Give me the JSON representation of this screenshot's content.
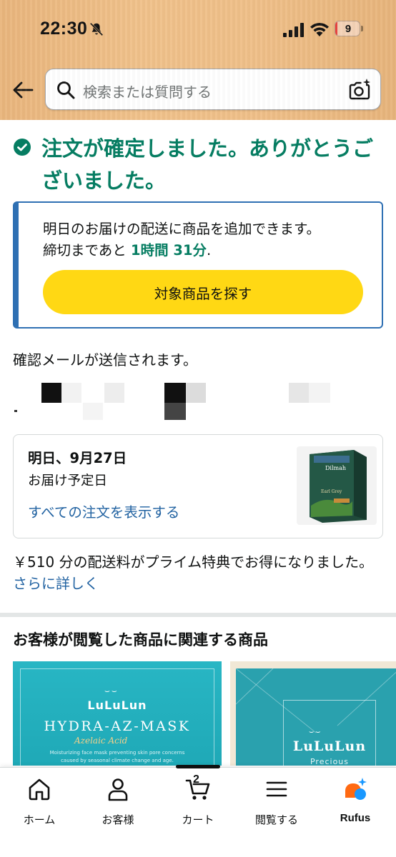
{
  "status_bar": {
    "time": "22:30",
    "battery_level": "9",
    "battery_fraction": 0.09
  },
  "search": {
    "placeholder": "検索または質問する"
  },
  "confirmation": {
    "message": "注文が確定しました。ありがとうございました。"
  },
  "delivery_upsell": {
    "line1": "明日のお届けの配送に商品を追加できます。",
    "line2_prefix": "締切まであと ",
    "time_left": "1時間 31分",
    "line2_suffix": ".",
    "button_label": "対象商品を探す",
    "accent_color": "#2f70b3",
    "button_color": "#ffd814"
  },
  "email_note": "確認メールが送信されます。",
  "order": {
    "date": "明日、9月27日",
    "subtitle": "お届け予定日",
    "view_all_link": "すべての注文を表示する",
    "product_brand": "Dilmah",
    "product_name": "Earl Grey"
  },
  "prime": {
    "text": "￥510 分の配送料がプライム特典でお得になりました。",
    "link": "さらに詳しく"
  },
  "recommendations": {
    "title": "お客様が閲覧した商品に関連する商品",
    "items": [
      {
        "brand": "LuLuLun",
        "product": "HYDRA-AZ-MASK",
        "script": "Azelaic Acid",
        "small1": "Moisturizing face mask preventing skin pore concerns",
        "small2": "caused by seasonal climate change and age."
      },
      {
        "brand": "LuLuLun",
        "sub": "Precious"
      }
    ]
  },
  "tabbar": {
    "tabs": [
      {
        "label": "ホーム",
        "icon": "home-icon"
      },
      {
        "label": "お客様",
        "icon": "person-icon"
      },
      {
        "label": "カート",
        "icon": "cart-icon",
        "count": "2"
      },
      {
        "label": "閲覧する",
        "icon": "menu-icon"
      },
      {
        "label": "Rufus",
        "icon": "rufus-icon"
      }
    ]
  },
  "colors": {
    "success_green": "#067d62",
    "link_blue": "#2162a1",
    "header_tan": "#f0c18a"
  }
}
